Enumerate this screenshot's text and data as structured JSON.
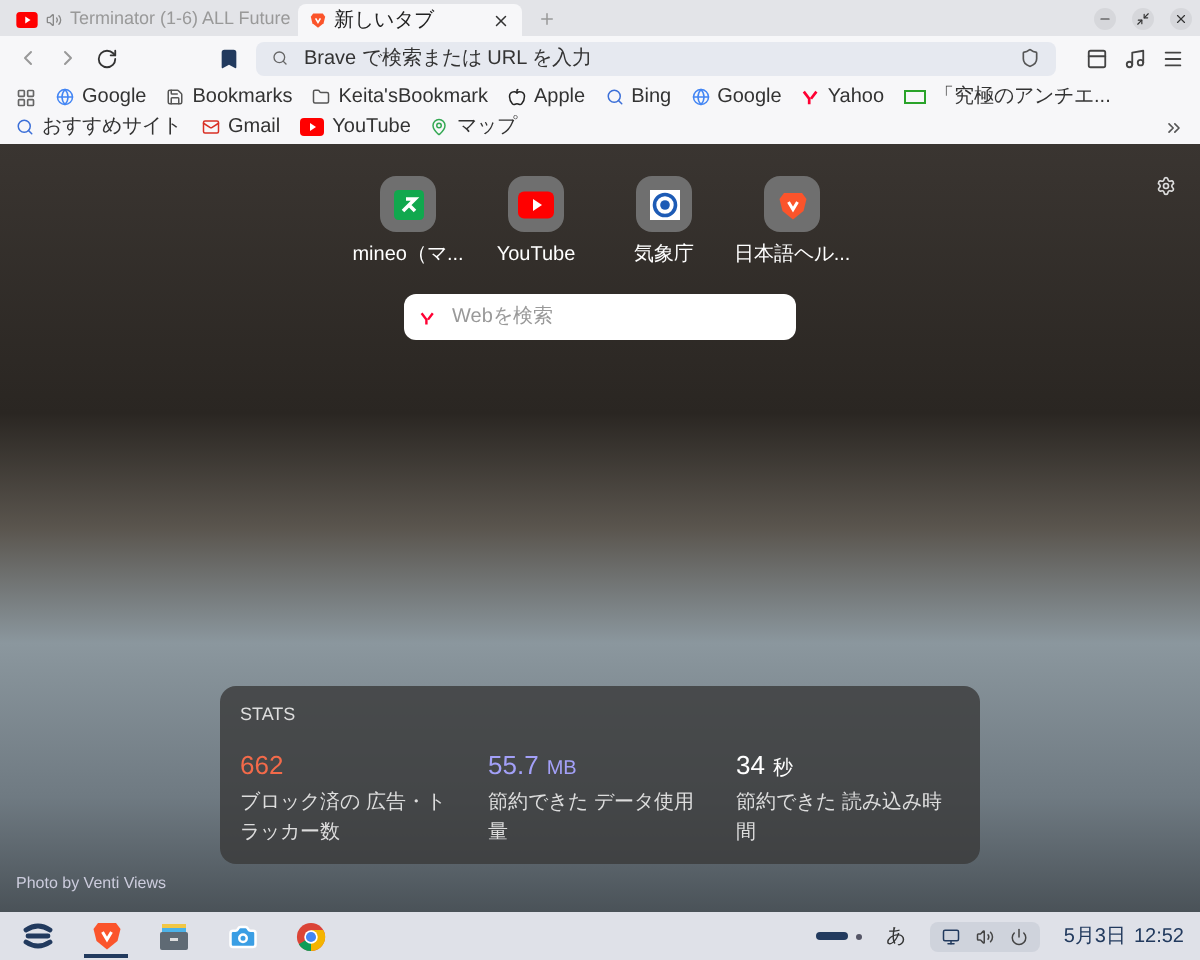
{
  "tabs": [
    {
      "title": "Terminator (1-6) ALL Future",
      "kind": "youtube",
      "audio": true,
      "selected": false
    },
    {
      "title": "新しいタブ",
      "kind": "brave",
      "audio": false,
      "selected": true
    }
  ],
  "address_bar": {
    "placeholder": "Brave で検索または URL を入力"
  },
  "bookmarks": [
    {
      "label": "Google",
      "kind": "google"
    },
    {
      "label": "Bookmarks",
      "kind": "save"
    },
    {
      "label": "Keita'sBookmark",
      "kind": "folder"
    },
    {
      "label": "Apple",
      "kind": "apple"
    },
    {
      "label": "Bing",
      "kind": "search"
    },
    {
      "label": "Google",
      "kind": "google"
    },
    {
      "label": "Yahoo",
      "kind": "yahoo"
    },
    {
      "label": "「究極のアンチエ...",
      "kind": "page"
    },
    {
      "label": "おすすめサイト",
      "kind": "search"
    },
    {
      "label": "Gmail",
      "kind": "mail"
    },
    {
      "label": "YouTube",
      "kind": "youtube"
    },
    {
      "label": "マップ",
      "kind": "map"
    }
  ],
  "top_sites": [
    {
      "label": "mineo（マ...",
      "kind": "mineo"
    },
    {
      "label": "YouTube",
      "kind": "youtube"
    },
    {
      "label": "気象庁",
      "kind": "weather"
    },
    {
      "label": "日本語ヘル...",
      "kind": "brave"
    }
  ],
  "search": {
    "placeholder": "Webを検索"
  },
  "stats": {
    "title": "STATS",
    "items": [
      {
        "value": "662",
        "label": "ブロック済の 広告・トラッカー数",
        "color": "#f36a4a"
      },
      {
        "value": "55.7",
        "unit": "MB",
        "label": "節約できた データ使用量",
        "color": "#a3a0f8"
      },
      {
        "value": "34",
        "unit": "秒",
        "label": "節約できた 読み込み時間",
        "color": "#ffffff"
      }
    ]
  },
  "photo_credit": "Photo by Venti Views",
  "taskbar": {
    "apps": [
      {
        "kind": "launcher",
        "active": false
      },
      {
        "kind": "brave",
        "active": true
      },
      {
        "kind": "files",
        "active": false
      },
      {
        "kind": "camera",
        "active": false
      },
      {
        "kind": "chrome",
        "active": false
      }
    ],
    "ime": "あ",
    "date": "5月3日",
    "time": "12:52"
  }
}
